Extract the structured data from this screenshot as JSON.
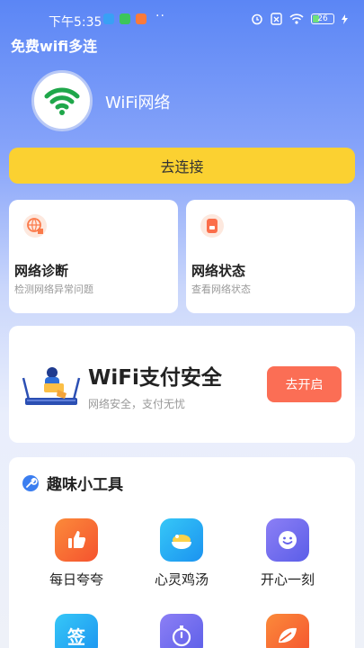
{
  "status_bar": {
    "time": "下午5:35",
    "dots": "··",
    "battery": "26"
  },
  "app_title": "免费wifi多连",
  "wifi": {
    "name": "WiFi网络",
    "connect_label": "去连接"
  },
  "features": [
    {
      "title": "网络诊断",
      "subtitle": "检测网络异常问题",
      "icon": "network-diagnosis-icon"
    },
    {
      "title": "网络状态",
      "subtitle": "查看网络状态",
      "icon": "network-status-icon"
    }
  ],
  "pay_security": {
    "title": "WiFi支付安全",
    "subtitle": "网络安全，支付无忧",
    "button": "去开启"
  },
  "tools": {
    "title": "趣味小工具",
    "items": [
      {
        "label": "每日夸夸",
        "icon": "thumbs-up-icon"
      },
      {
        "label": "心灵鸡汤",
        "icon": "chicken-soup-icon"
      },
      {
        "label": "开心一刻",
        "icon": "smile-icon"
      },
      {
        "label": "",
        "icon": "sign-in-icon",
        "glyph": "签"
      },
      {
        "label": "",
        "icon": "stopwatch-icon"
      },
      {
        "label": "",
        "icon": "leaf-icon"
      }
    ]
  },
  "colors": {
    "accent_yellow": "#fbd131",
    "accent_red": "#fb6e55",
    "wifi_green": "#1fa74a"
  }
}
